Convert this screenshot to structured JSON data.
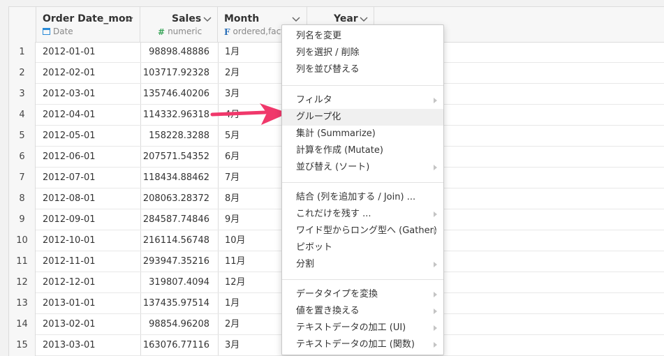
{
  "columns": {
    "order_date": {
      "name": "Order Date_mon",
      "type": "Date",
      "icon": "calendar-icon"
    },
    "sales": {
      "name": "Sales",
      "type": "numeric",
      "icon": "hash-icon"
    },
    "month": {
      "name": "Month",
      "type": "ordered,factor",
      "icon": "factor-icon"
    },
    "year": {
      "name": "Year"
    }
  },
  "rows": [
    {
      "idx": "1",
      "date": "2012-01-01",
      "sales": "98898.48886",
      "month": "1月"
    },
    {
      "idx": "2",
      "date": "2012-02-01",
      "sales": "103717.92328",
      "month": "2月"
    },
    {
      "idx": "3",
      "date": "2012-03-01",
      "sales": "135746.40206",
      "month": "3月"
    },
    {
      "idx": "4",
      "date": "2012-04-01",
      "sales": "114332.96318",
      "month": "4月"
    },
    {
      "idx": "5",
      "date": "2012-05-01",
      "sales": "158228.3288",
      "month": "5月"
    },
    {
      "idx": "6",
      "date": "2012-06-01",
      "sales": "207571.54352",
      "month": "6月"
    },
    {
      "idx": "7",
      "date": "2012-07-01",
      "sales": "118434.88462",
      "month": "7月"
    },
    {
      "idx": "8",
      "date": "2012-08-01",
      "sales": "208063.28372",
      "month": "8月"
    },
    {
      "idx": "9",
      "date": "2012-09-01",
      "sales": "284587.74846",
      "month": "9月"
    },
    {
      "idx": "10",
      "date": "2012-10-01",
      "sales": "216114.56748",
      "month": "10月"
    },
    {
      "idx": "11",
      "date": "2012-11-01",
      "sales": "293947.35216",
      "month": "11月"
    },
    {
      "idx": "12",
      "date": "2012-12-01",
      "sales": "319807.4094",
      "month": "12月"
    },
    {
      "idx": "13",
      "date": "2013-01-01",
      "sales": "137435.97514",
      "month": "1月"
    },
    {
      "idx": "14",
      "date": "2013-02-01",
      "sales": "98854.96208",
      "month": "2月"
    },
    {
      "idx": "15",
      "date": "2013-03-01",
      "sales": "163076.77116",
      "month": "3月"
    }
  ],
  "menu": {
    "rename": "列名を変更",
    "select_delete": "列を選択 / 削除",
    "reorder": "列を並び替える",
    "filter": "フィルタ",
    "group": "グループ化",
    "summarize": "集計 (Summarize)",
    "mutate": "計算を作成 (Mutate)",
    "sort": "並び替え (ソート)",
    "join": "結合 (列を追加する / Join) ...",
    "keep_only": "これだけを残す ...",
    "gather": "ワイド型からロング型へ (Gather)",
    "pivot": "ピボット",
    "split": "分割",
    "convert_type": "データタイプを変換",
    "replace": "値を置き換える",
    "text_ui": "テキストデータの加工 (UI)",
    "text_func": "テキストデータの加工 (関数)"
  },
  "colors": {
    "accent_arrow": "#f0386b",
    "date_icon": "#2a8bd8",
    "numeric_icon": "#3aa55a",
    "factor_icon": "#2a6fb8"
  }
}
